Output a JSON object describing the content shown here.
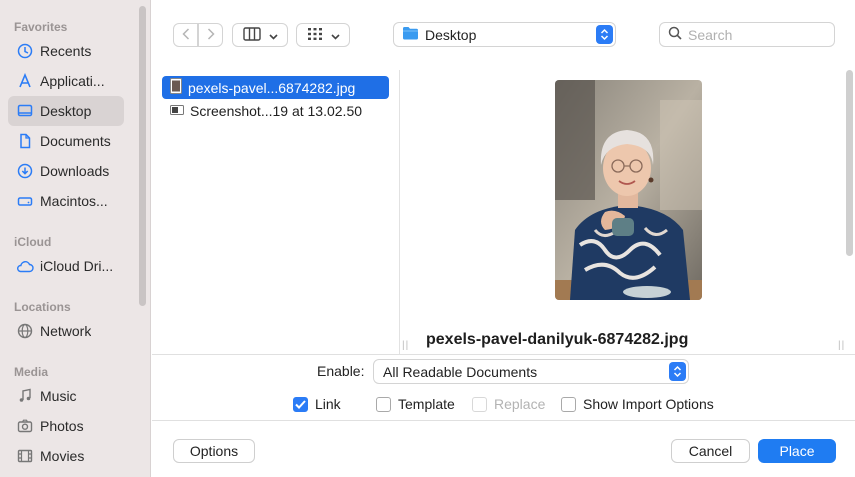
{
  "sidebar": {
    "sections": [
      {
        "title": "Favorites",
        "items": [
          {
            "label": "Recents",
            "icon": "clock-icon"
          },
          {
            "label": "Applicati...",
            "icon": "applications-icon"
          },
          {
            "label": "Desktop",
            "icon": "desktop-icon",
            "active": true
          },
          {
            "label": "Documents",
            "icon": "document-icon"
          },
          {
            "label": "Downloads",
            "icon": "download-icon"
          },
          {
            "label": "Macintos...",
            "icon": "drive-icon"
          }
        ]
      },
      {
        "title": "iCloud",
        "items": [
          {
            "label": "iCloud Dri...",
            "icon": "cloud-icon"
          }
        ]
      },
      {
        "title": "Locations",
        "items": [
          {
            "label": "Network",
            "icon": "network-icon"
          }
        ]
      },
      {
        "title": "Media",
        "items": [
          {
            "label": "Music",
            "icon": "music-icon"
          },
          {
            "label": "Photos",
            "icon": "camera-icon"
          },
          {
            "label": "Movies",
            "icon": "film-icon"
          }
        ]
      }
    ]
  },
  "toolbar": {
    "location": "Desktop",
    "search_placeholder": "Search"
  },
  "files": [
    {
      "name": "pexels-pavel...6874282.jpg",
      "selected": true
    },
    {
      "name": "Screenshot...19 at 13.02.50",
      "selected": false
    }
  ],
  "preview": {
    "filename": "pexels-pavel-danilyuk-6874282.jpg"
  },
  "options": {
    "enable_label": "Enable:",
    "enable_value": "All Readable Documents",
    "link_label": "Link",
    "link_checked": true,
    "template_label": "Template",
    "replace_label": "Replace",
    "show_import_label": "Show Import Options"
  },
  "buttons": {
    "options": "Options",
    "cancel": "Cancel",
    "place": "Place"
  },
  "colors": {
    "accent": "#1f7cf2",
    "sidebar_bg": "#ece6e6"
  }
}
